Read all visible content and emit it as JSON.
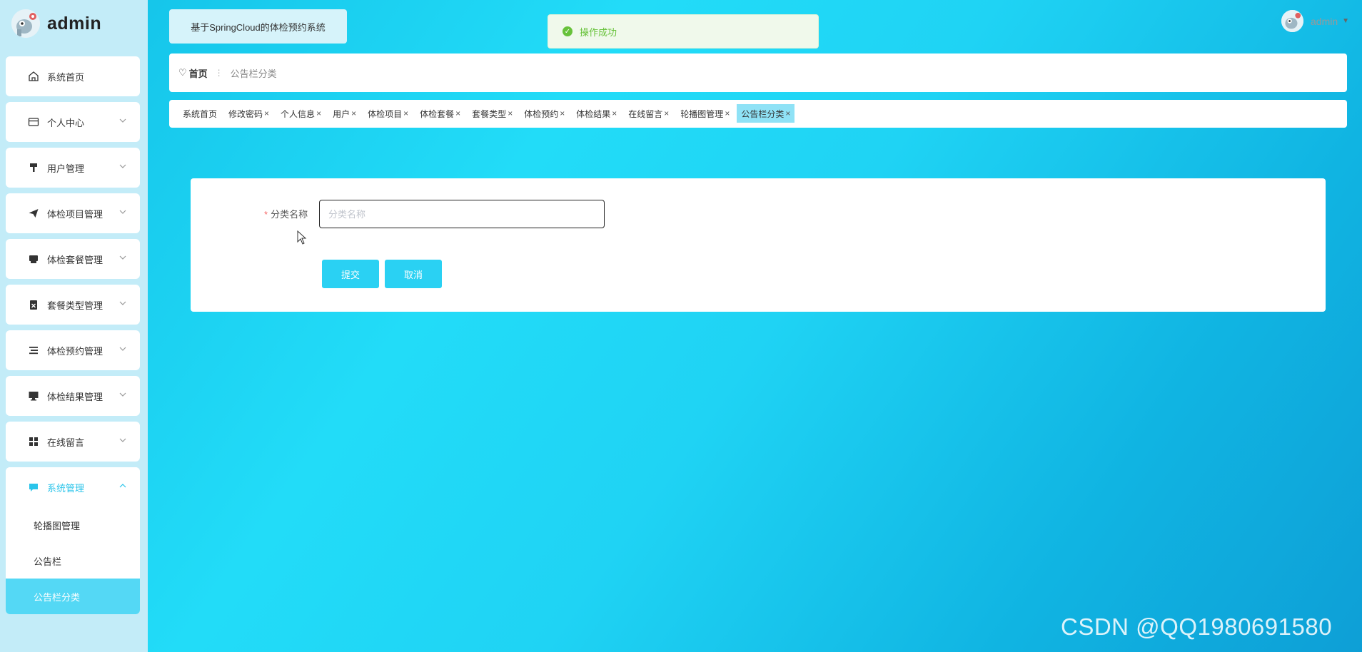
{
  "brand": {
    "name": "admin"
  },
  "system_title": "基于SpringCloud的体检预约系统",
  "toast": {
    "message": "操作成功",
    "color": "#67c23a"
  },
  "user": {
    "name": "admin"
  },
  "sidebar": {
    "items": [
      {
        "label": "系统首页",
        "icon": "home-icon",
        "has_chevron": false
      },
      {
        "label": "个人中心",
        "icon": "card-icon",
        "has_chevron": true
      },
      {
        "label": "用户管理",
        "icon": "hammer-icon",
        "has_chevron": true
      },
      {
        "label": "体检项目管理",
        "icon": "paper-plane-icon",
        "has_chevron": true
      },
      {
        "label": "体检套餐管理",
        "icon": "printer-icon",
        "has_chevron": true
      },
      {
        "label": "套餐类型管理",
        "icon": "clipboard-x-icon",
        "has_chevron": true
      },
      {
        "label": "体检预约管理",
        "icon": "list-icon",
        "has_chevron": true
      },
      {
        "label": "体检结果管理",
        "icon": "monitor-icon",
        "has_chevron": true
      },
      {
        "label": "在线留言",
        "icon": "grid-icon",
        "has_chevron": true
      }
    ],
    "expanded_group": {
      "label": "系统管理",
      "icon": "chat-icon",
      "children": [
        "轮播图管理",
        "公告栏",
        "公告栏分类"
      ],
      "active_child": "公告栏分类"
    }
  },
  "breadcrumb": {
    "home": "首页",
    "current": "公告栏分类"
  },
  "tabs": [
    {
      "label": "系统首页",
      "closable": false,
      "active": false
    },
    {
      "label": "修改密码",
      "closable": true,
      "active": false
    },
    {
      "label": "个人信息",
      "closable": true,
      "active": false
    },
    {
      "label": "用户",
      "closable": true,
      "active": false
    },
    {
      "label": "体检项目",
      "closable": true,
      "active": false
    },
    {
      "label": "体检套餐",
      "closable": true,
      "active": false
    },
    {
      "label": "套餐类型",
      "closable": true,
      "active": false
    },
    {
      "label": "体检预约",
      "closable": true,
      "active": false
    },
    {
      "label": "体检结果",
      "closable": true,
      "active": false
    },
    {
      "label": "在线留言",
      "closable": true,
      "active": false
    },
    {
      "label": "轮播图管理",
      "closable": true,
      "active": false
    },
    {
      "label": "公告栏分类",
      "closable": true,
      "active": true
    }
  ],
  "form": {
    "field_label": "分类名称",
    "required_mark": "*",
    "field_value": "",
    "field_placeholder": "分类名称",
    "submit_label": "提交",
    "cancel_label": "取消"
  },
  "watermark": "CSDN @QQ1980691580",
  "colors": {
    "accent": "#2ad1f3",
    "active_tab": "#8fe2f6",
    "sidebar_bg": "#c3ecf8",
    "success": "#67c23a"
  }
}
